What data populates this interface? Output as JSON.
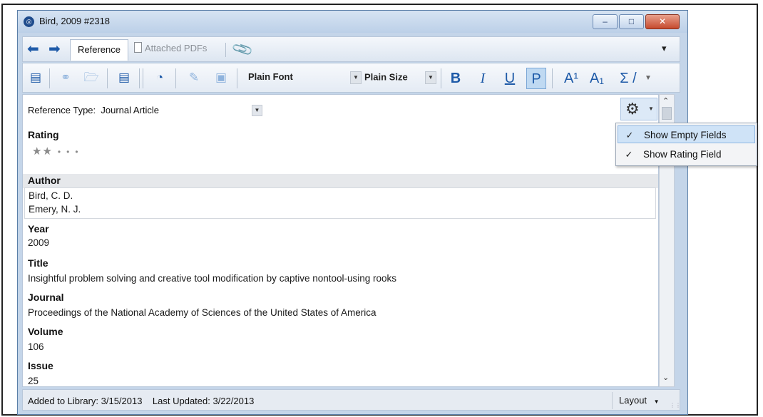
{
  "window": {
    "title": "Bird, 2009 #2318",
    "app_icon_glyph": "◎",
    "buttons": {
      "minimize": "–",
      "maximize": "□",
      "close": "✕"
    }
  },
  "nav": {
    "back_icon": "⬅",
    "forward_icon": "➡",
    "tabs": {
      "reference": "Reference",
      "attached_pdfs": "Attached PDFs"
    },
    "attachment_icon": "📎",
    "overflow_icon": "▾"
  },
  "toolbar": {
    "font": "Plain Font",
    "size": "Plain Size",
    "bold": "B",
    "italic": "I",
    "underline": "U",
    "plain": "P",
    "superscript": "A¹",
    "subscript": "A₁",
    "symbol": "Σ /"
  },
  "reference": {
    "type_label": "Reference Type:",
    "type_value": "Journal Article",
    "fields": {
      "rating": {
        "label": "Rating",
        "stars": 2,
        "max": 5
      },
      "author": {
        "label": "Author",
        "values": [
          "Bird, C. D.",
          "Emery, N. J."
        ]
      },
      "year": {
        "label": "Year",
        "value": "2009"
      },
      "title": {
        "label": "Title",
        "value": "Insightful problem solving and creative tool modification by captive nontool-using rooks"
      },
      "journal": {
        "label": "Journal",
        "value": "Proceedings of the National Academy of Sciences of the United States of America"
      },
      "volume": {
        "label": "Volume",
        "value": "106"
      },
      "issue": {
        "label": "Issue",
        "value": "25"
      }
    }
  },
  "popup_menu": {
    "items": [
      {
        "label": "Show Empty Fields",
        "checked": true
      },
      {
        "label": "Show Rating Field",
        "checked": true
      }
    ]
  },
  "status": {
    "added": "Added to Library: 3/15/2013",
    "updated": "Last Updated: 3/22/2013",
    "layout": "Layout"
  },
  "colors": {
    "accent": "#1e5aa8",
    "menu_highlight": "#cfe3f7",
    "window_frame": "#c4d5e9"
  }
}
